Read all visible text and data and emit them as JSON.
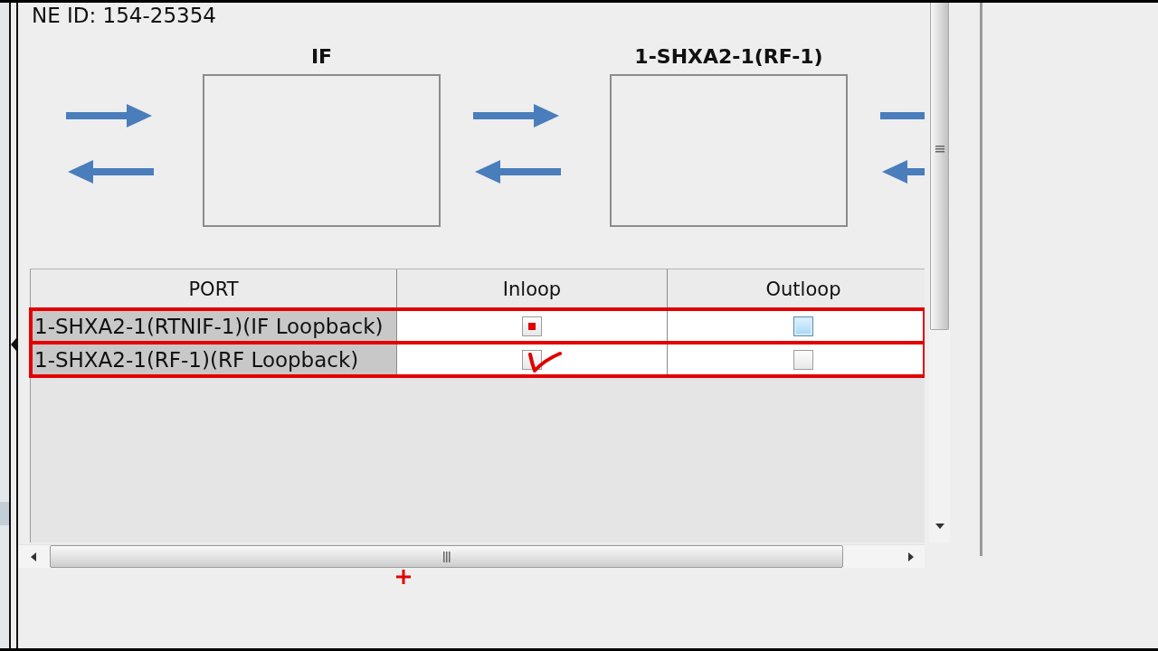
{
  "ne_id": "NE ID: 154-25354",
  "diagram": {
    "blocks": [
      {
        "title": "IF"
      },
      {
        "title": "1-SHXA2-1(RF-1)"
      }
    ]
  },
  "table": {
    "columns": [
      "PORT",
      "Inloop",
      "Outloop"
    ],
    "rows": [
      {
        "port": "1-SHXA2-1(RTNIF-1)(IF Loopback)",
        "outlined": true,
        "inloop": {
          "checked": true,
          "focused": false,
          "marked": false
        },
        "outloop": {
          "checked": false,
          "focused": true,
          "marked": false
        }
      },
      {
        "port": "1-SHXA2-1(RF-1)(RF Loopback)",
        "outlined": true,
        "inloop": {
          "checked": false,
          "focused": false,
          "marked": true
        },
        "outloop": {
          "checked": false,
          "focused": false,
          "marked": false
        }
      }
    ]
  },
  "cursor": {
    "kind": "crosshair"
  }
}
